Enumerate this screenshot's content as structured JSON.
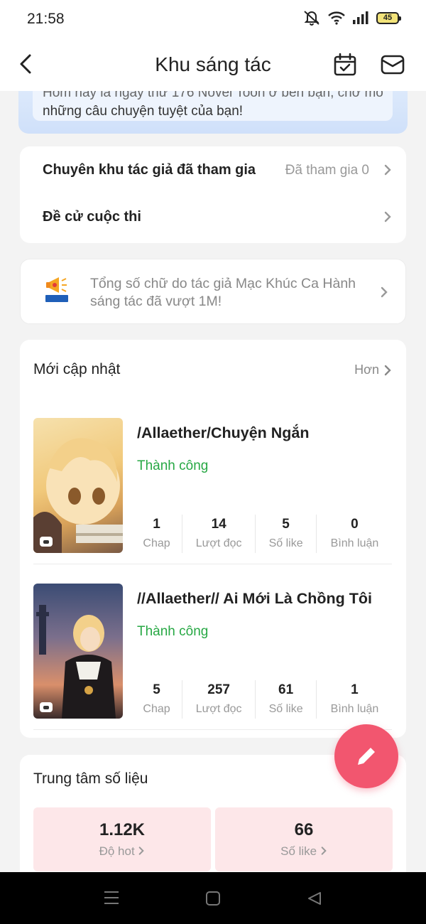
{
  "status_bar": {
    "time": "21:58",
    "battery": "45"
  },
  "header": {
    "title": "Khu sáng tác"
  },
  "banner": {
    "line1": "Hôm nay là ngày thứ 176 Novel Toon ở bên bạn, chờ mong",
    "line2": "những câu chuyện tuyệt của bạn!"
  },
  "links": {
    "joined_label": "Chuyên khu tác giả đã tham gia",
    "joined_value": "Đã tham gia 0",
    "contest_label": "Đề cử cuộc thi"
  },
  "notice": {
    "text": "Tổng số chữ do tác giả Mạc Khúc Ca Hành sáng tác đã vượt 1M!"
  },
  "updates": {
    "title": "Mới cập nhật",
    "more": "Hơn",
    "items": [
      {
        "name": "/Allaether/Chuyện Ngắn",
        "status": "Thành công",
        "stats": [
          {
            "value": "1",
            "label": "Chap"
          },
          {
            "value": "14",
            "label": "Lượt đọc"
          },
          {
            "value": "5",
            "label": "Số like"
          },
          {
            "value": "0",
            "label": "Bình luận"
          }
        ]
      },
      {
        "name": "//Allaether// Ai Mới Là Chồng Tôi",
        "status": "Thành công",
        "stats": [
          {
            "value": "5",
            "label": "Chap"
          },
          {
            "value": "257",
            "label": "Lượt đọc"
          },
          {
            "value": "61",
            "label": "Số like"
          },
          {
            "value": "1",
            "label": "Bình luận"
          }
        ]
      }
    ]
  },
  "data_center": {
    "title": "Trung tâm số liệu",
    "hot_value": "1.12K",
    "hot_label": "Độ hot",
    "like_value": "66",
    "like_label": "Số like"
  },
  "colors": {
    "accent": "#f2566f",
    "success": "#27a844",
    "stat_box": "#fde7e9"
  }
}
